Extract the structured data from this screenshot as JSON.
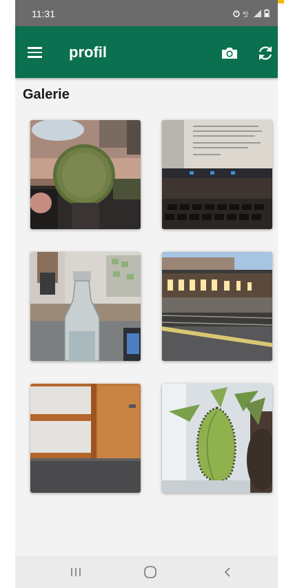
{
  "status_bar": {
    "time": "11:31"
  },
  "app_bar": {
    "title": "profil"
  },
  "gallery": {
    "heading": "Galerie",
    "photos": [
      {
        "subject": "cactus-on-windowsill"
      },
      {
        "subject": "laptop-screen-document"
      },
      {
        "subject": "glass-bottle-on-table"
      },
      {
        "subject": "train-station-platform"
      },
      {
        "subject": "wooden-door-corner"
      },
      {
        "subject": "succulent-plant-leaves"
      }
    ]
  },
  "colors": {
    "app_bar": "#0b7050",
    "status_bar": "#6b6b6b",
    "background": "#f3f3f3",
    "nav_bar": "#ebebeb"
  }
}
